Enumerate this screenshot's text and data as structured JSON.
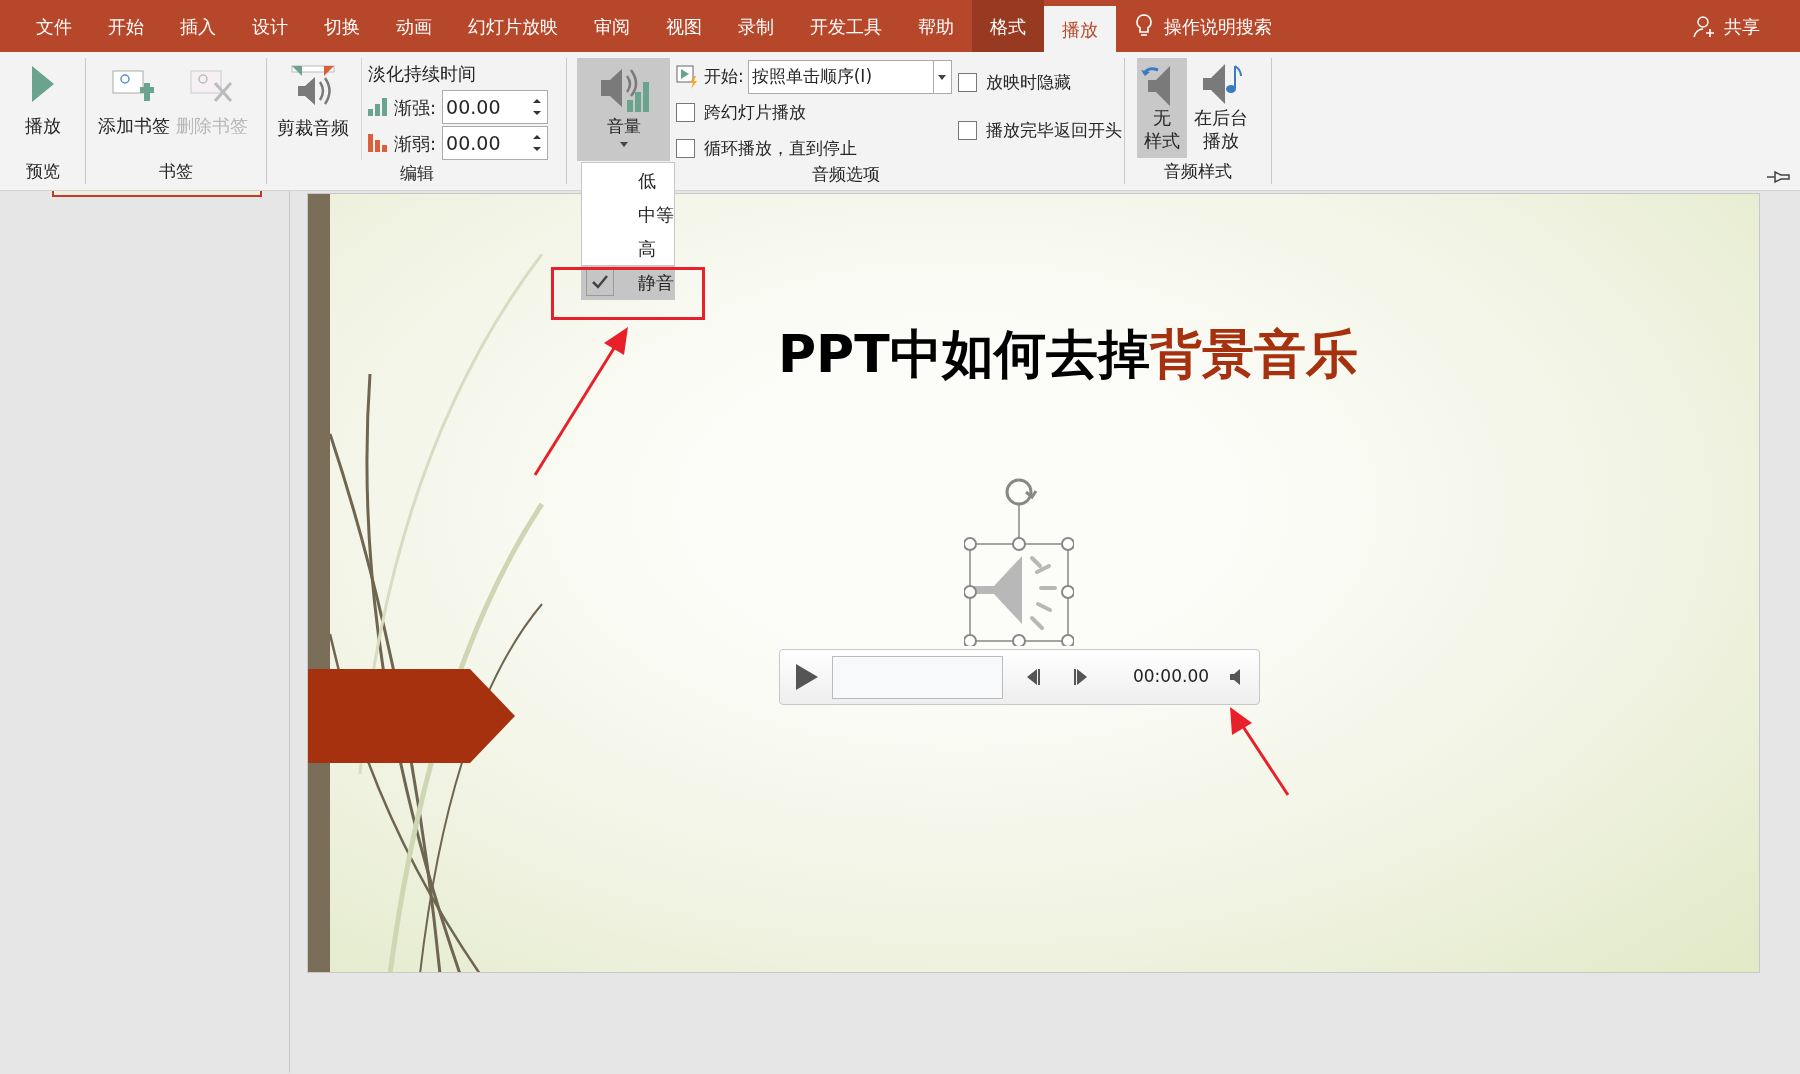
{
  "menu_tabs": [
    {
      "label": "文件",
      "kind": "standard",
      "selected": false
    },
    {
      "label": "开始",
      "kind": "standard",
      "selected": false
    },
    {
      "label": "插入",
      "kind": "standard",
      "selected": false
    },
    {
      "label": "设计",
      "kind": "standard",
      "selected": false
    },
    {
      "label": "切换",
      "kind": "standard",
      "selected": false
    },
    {
      "label": "动画",
      "kind": "standard",
      "selected": false
    },
    {
      "label": "幻灯片放映",
      "kind": "standard",
      "selected": false
    },
    {
      "label": "审阅",
      "kind": "standard",
      "selected": false
    },
    {
      "label": "视图",
      "kind": "standard",
      "selected": false
    },
    {
      "label": "录制",
      "kind": "standard",
      "selected": false
    },
    {
      "label": "开发工具",
      "kind": "standard",
      "selected": false
    },
    {
      "label": "帮助",
      "kind": "standard",
      "selected": false
    },
    {
      "label": "格式",
      "kind": "contextual",
      "selected": false
    },
    {
      "label": "播放",
      "kind": "contextual",
      "selected": true
    }
  ],
  "tell_me": "操作说明搜索",
  "share": "共享",
  "preview": {
    "play": "播放",
    "label": "预览"
  },
  "bookmarks": {
    "add": "添加书签",
    "remove": "删除书签",
    "remove_disabled": true,
    "label": "书签"
  },
  "editing": {
    "trim": "剪裁音频",
    "fade_title": "淡化持续时间",
    "fade_in_label": "渐强:",
    "fade_in": "00.00",
    "fade_out_label": "渐弱:",
    "fade_out": "00.00",
    "label": "编辑"
  },
  "audio_options": {
    "volume": "音量",
    "volume_open": true,
    "start_label": "开始:",
    "start_value": "按照单击顺序(I)",
    "checkboxes": [
      {
        "label": "跨幻灯片播放",
        "checked": false
      },
      {
        "label": "循环播放，直到停止",
        "checked": false
      },
      {
        "label": "放映时隐藏",
        "checked": false
      },
      {
        "label": "播放完毕返回开头",
        "checked": false
      }
    ],
    "label": "音频选项"
  },
  "audio_styles": {
    "buttons": [
      {
        "lines": [
          "无",
          "样式"
        ],
        "selected": true
      },
      {
        "lines": [
          "在后台",
          "播放"
        ],
        "selected": false
      }
    ],
    "label": "音频样式"
  },
  "volume_menu": [
    {
      "label": "低",
      "checked": false
    },
    {
      "label": "中等",
      "checked": false
    },
    {
      "label": "高",
      "checked": false
    },
    {
      "label": "静音",
      "checked": true
    }
  ],
  "slide": {
    "title_parts": [
      {
        "text": "PPT中如何去掉",
        "color": "#000000"
      },
      {
        "text": "背景音乐",
        "color": "#a5310f"
      }
    ],
    "player": {
      "time": "00:00.00"
    }
  }
}
